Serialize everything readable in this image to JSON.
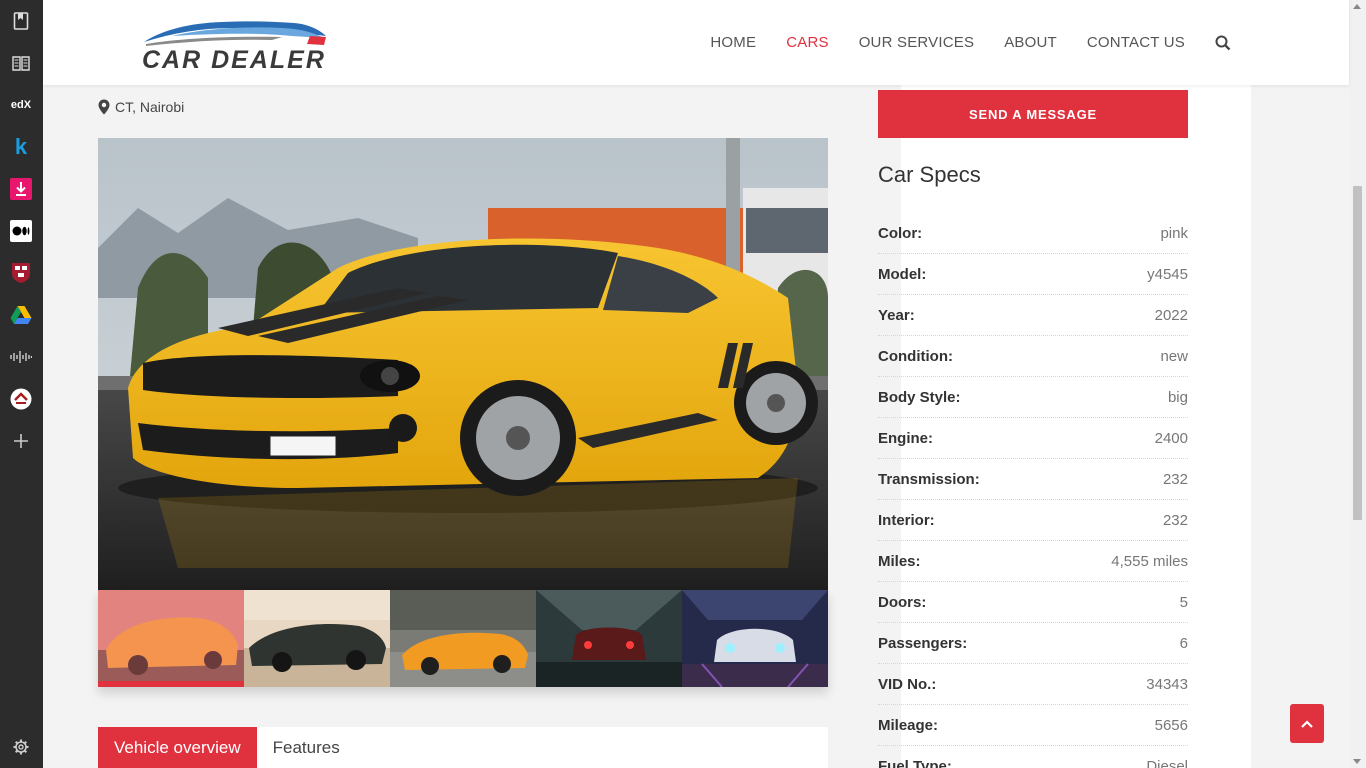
{
  "header": {
    "logo_text": "CAR DEALER",
    "nav": [
      "HOME",
      "CARS",
      "OUR SERVICES",
      "ABOUT",
      "CONTACT US"
    ],
    "active_nav": "CARS"
  },
  "listing": {
    "location": "CT, Nairobi"
  },
  "actions": {
    "send_message": "SEND A MESSAGE"
  },
  "specs": {
    "title": "Car Specs",
    "rows": [
      {
        "label": "Color:",
        "value": "pink"
      },
      {
        "label": "Model:",
        "value": "y4545"
      },
      {
        "label": "Year:",
        "value": "2022"
      },
      {
        "label": "Condition:",
        "value": "new"
      },
      {
        "label": "Body Style:",
        "value": "big"
      },
      {
        "label": "Engine:",
        "value": "2400"
      },
      {
        "label": "Transmission:",
        "value": "232"
      },
      {
        "label": "Interior:",
        "value": "232"
      },
      {
        "label": "Miles:",
        "value": "4,555 miles"
      },
      {
        "label": "Doors:",
        "value": "5"
      },
      {
        "label": "Passengers:",
        "value": "6"
      },
      {
        "label": "VID No.:",
        "value": "34343"
      },
      {
        "label": "Mileage:",
        "value": "5656"
      },
      {
        "label": "Fuel Type:",
        "value": "Diesel"
      }
    ]
  },
  "tabs": [
    "Vehicle overview",
    "Features"
  ],
  "active_tab": 0,
  "colors": {
    "accent": "#e0313e",
    "sidebar": "#2c2c2c",
    "car_yellow": "#f2b81c"
  },
  "sidebar_icons": [
    "bookmark-icon",
    "reader-icon",
    "edx-icon",
    "k-icon",
    "download-icon",
    "medium-icon",
    "harvard-icon",
    "google-drive-icon",
    "cisco-icon",
    "equity-icon",
    "add-icon",
    "settings-icon"
  ],
  "sidebar_labels": {
    "edx": "edX",
    "k": "k"
  }
}
